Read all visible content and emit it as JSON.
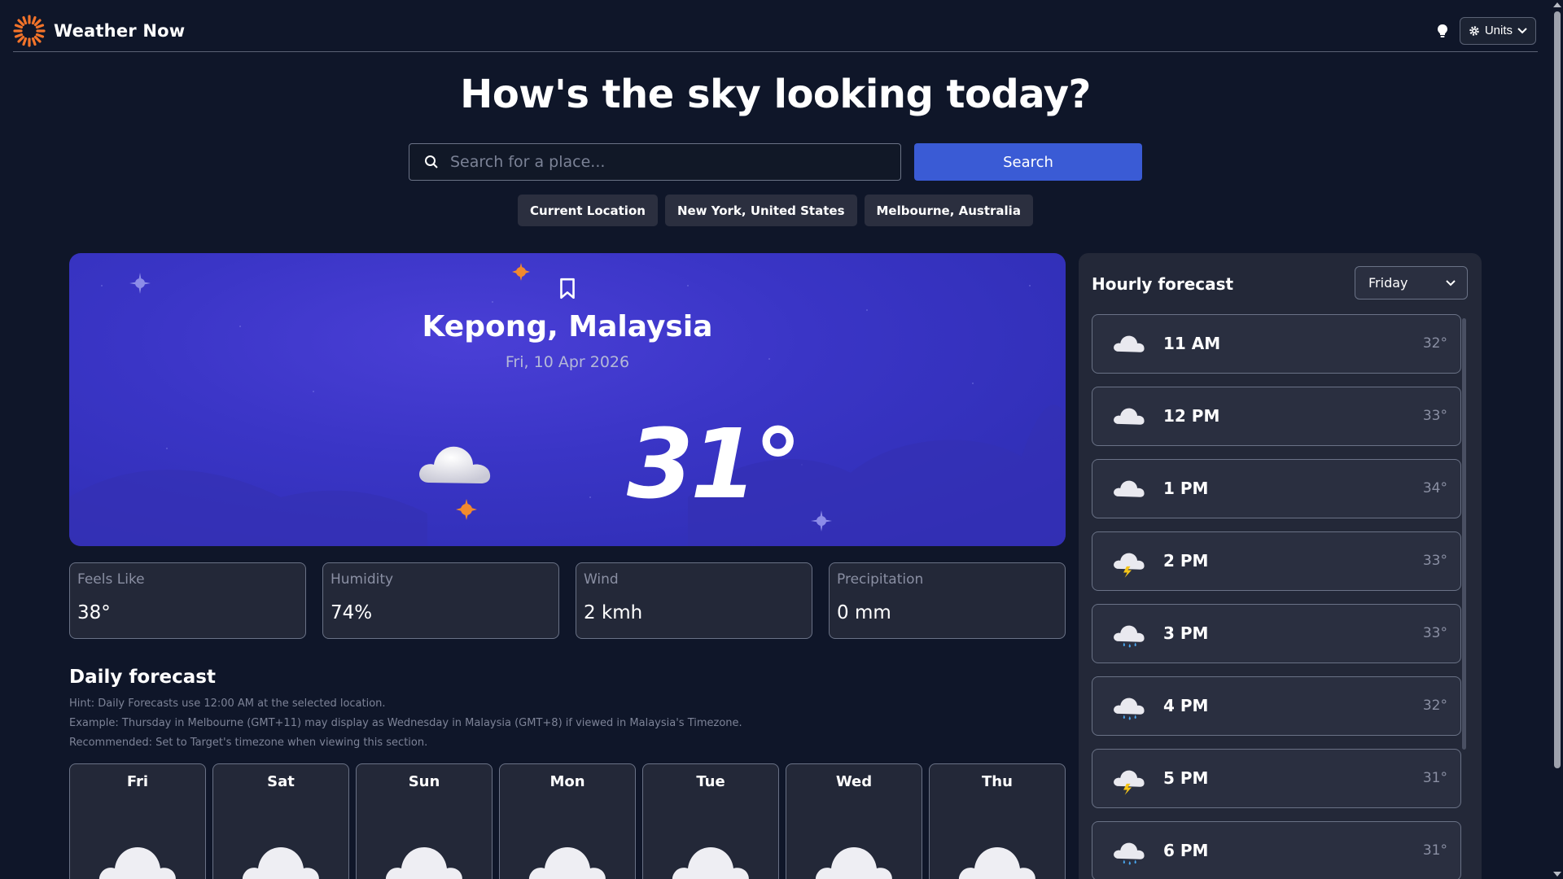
{
  "app": {
    "title": "Weather Now"
  },
  "header": {
    "units_label": "Units"
  },
  "hero": {
    "headline": "How's the sky looking today?",
    "search_placeholder": "Search for a place...",
    "search_button": "Search",
    "quick_locations": [
      "Current Location",
      "New York, United States",
      "Melbourne, Australia"
    ]
  },
  "current": {
    "city": "Kepong, Malaysia",
    "date": "Fri, 10 Apr 2026",
    "temperature": "31°",
    "icon": "cloud-icon"
  },
  "stats": [
    {
      "label": "Feels Like",
      "value": "38°"
    },
    {
      "label": "Humidity",
      "value": "74%"
    },
    {
      "label": "Wind",
      "value": "2 kmh"
    },
    {
      "label": "Precipitation",
      "value": "0 mm"
    }
  ],
  "daily": {
    "title": "Daily forecast",
    "hints": [
      "Hint: Daily Forecasts use 12:00 AM at the selected location.",
      "Example: Thursday in Melbourne (GMT+11) may display as Wednesday in Malaysia (GMT+8) if viewed in Malaysia's Timezone.",
      "Recommended: Set to Target's timezone when viewing this section."
    ],
    "days": [
      "Fri",
      "Sat",
      "Sun",
      "Mon",
      "Tue",
      "Wed",
      "Thu"
    ]
  },
  "hourly": {
    "title": "Hourly forecast",
    "selected_day": "Friday",
    "hours": [
      {
        "time": "11 AM",
        "temp": "32°",
        "icon": "cloud-icon"
      },
      {
        "time": "12 PM",
        "temp": "33°",
        "icon": "cloud-icon"
      },
      {
        "time": "1 PM",
        "temp": "34°",
        "icon": "cloud-icon"
      },
      {
        "time": "2 PM",
        "temp": "33°",
        "icon": "thunderstorm-icon"
      },
      {
        "time": "3 PM",
        "temp": "33°",
        "icon": "rain-icon"
      },
      {
        "time": "4 PM",
        "temp": "32°",
        "icon": "rain-icon"
      },
      {
        "time": "5 PM",
        "temp": "31°",
        "icon": "thunderstorm-icon"
      },
      {
        "time": "6 PM",
        "temp": "31°",
        "icon": "rain-icon"
      }
    ]
  },
  "colors": {
    "background": "#0f1629",
    "accent": "#3a5bd5",
    "card": "#232838",
    "hero_card": "#3a35c6"
  }
}
